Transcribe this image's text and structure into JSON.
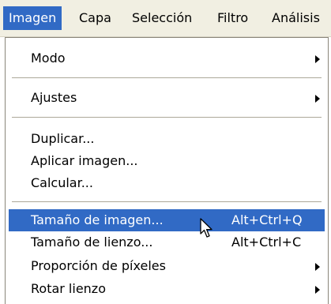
{
  "menubar": {
    "items": [
      {
        "label": "Imagen",
        "active": true
      },
      {
        "label": "Capa"
      },
      {
        "label": "Selección"
      },
      {
        "label": "Filtro"
      },
      {
        "label": "Análisis"
      }
    ]
  },
  "menu": {
    "items": [
      {
        "label": "Modo",
        "submenu": true
      },
      {
        "label": "Ajustes",
        "submenu": true
      },
      {
        "label": "Duplicar..."
      },
      {
        "label": "Aplicar imagen..."
      },
      {
        "label": "Calcular..."
      },
      {
        "label": "Tamaño de imagen...",
        "shortcut": "Alt+Ctrl+Q",
        "highlighted": true
      },
      {
        "label": "Tamaño de lienzo...",
        "shortcut": "Alt+Ctrl+C"
      },
      {
        "label": "Proporción de píxeles",
        "submenu": true
      },
      {
        "label": "Rotar lienzo",
        "submenu": true
      }
    ]
  },
  "colors": {
    "highlight": "#316ac5",
    "menubar_bg": "#f1efe2",
    "separator": "#aca899"
  },
  "cursor_icon": "arrow-pointer-icon"
}
